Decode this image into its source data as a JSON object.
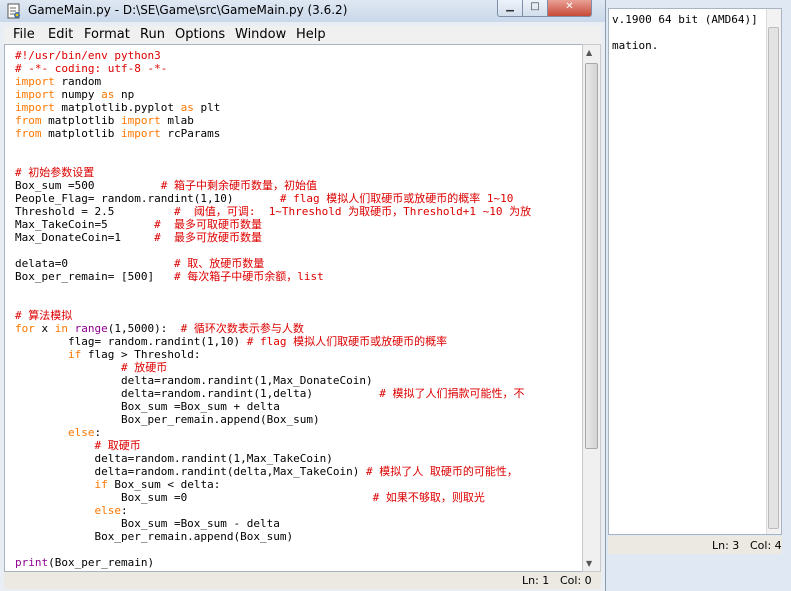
{
  "window": {
    "title": "GameMain.py - D:\\SE\\Game\\src\\GameMain.py (3.6.2)",
    "min_label": "▁",
    "max_label": "□",
    "close_label": "✕"
  },
  "menu": [
    "File",
    "Edit",
    "Format",
    "Run",
    "Options",
    "Window",
    "Help"
  ],
  "code": [
    [
      [
        "cm",
        "#!/usr/bin/env python3"
      ]
    ],
    [
      [
        "cm",
        "# -*- coding: utf-8 -*-"
      ]
    ],
    [
      [
        "kw",
        "import"
      ],
      [
        "nm",
        " random"
      ]
    ],
    [
      [
        "kw",
        "import"
      ],
      [
        "nm",
        " numpy "
      ],
      [
        "kw",
        "as"
      ],
      [
        "nm",
        " np"
      ]
    ],
    [
      [
        "kw",
        "import"
      ],
      [
        "nm",
        " matplotlib.pyplot "
      ],
      [
        "kw",
        "as"
      ],
      [
        "nm",
        " plt"
      ]
    ],
    [
      [
        "kw",
        "from"
      ],
      [
        "nm",
        " matplotlib "
      ],
      [
        "kw",
        "import"
      ],
      [
        "nm",
        " mlab"
      ]
    ],
    [
      [
        "kw",
        "from"
      ],
      [
        "nm",
        " matplotlib "
      ],
      [
        "kw",
        "import"
      ],
      [
        "nm",
        " rcParams"
      ]
    ],
    [],
    [],
    [
      [
        "cm",
        "# 初始参数设置"
      ]
    ],
    [
      [
        "nm",
        "Box_sum =500          "
      ],
      [
        "cm",
        "# 箱子中剩余硬币数量，初始值"
      ]
    ],
    [
      [
        "nm",
        "People_Flag= random.randint(1,10)       "
      ],
      [
        "cm",
        "# flag 模拟人们取硬币或放硬币的概率 1~10"
      ]
    ],
    [
      [
        "nm",
        "Threshold = 2.5         "
      ],
      [
        "cm",
        "#  阈值，可调:  1~Threshold 为取硬币，Threshold+1 ~10 为放"
      ]
    ],
    [
      [
        "nm",
        "Max_TakeCoin=5       "
      ],
      [
        "cm",
        "#  最多可取硬币数量"
      ]
    ],
    [
      [
        "nm",
        "Max_DonateCoin=1     "
      ],
      [
        "cm",
        "#  最多可放硬币数量"
      ]
    ],
    [],
    [
      [
        "nm",
        "delata=0                "
      ],
      [
        "cm",
        "# 取、放硬币数量"
      ]
    ],
    [
      [
        "nm",
        "Box_per_remain= [500]   "
      ],
      [
        "cm",
        "# 每次箱子中硬币余额，list"
      ]
    ],
    [],
    [],
    [
      [
        "cm",
        "# 算法模拟"
      ]
    ],
    [
      [
        "kw",
        "for"
      ],
      [
        "nm",
        " x "
      ],
      [
        "kw",
        "in"
      ],
      [
        "nm",
        " "
      ],
      [
        "bi",
        "range"
      ],
      [
        "nm",
        "(1,5000):  "
      ],
      [
        "cm",
        "# 循环次数表示参与人数"
      ]
    ],
    [
      [
        "nm",
        "        flag= random.randint(1,10) "
      ],
      [
        "cm",
        "# flag 模拟人们取硬币或放硬币的概率"
      ]
    ],
    [
      [
        "nm",
        "        "
      ],
      [
        "kw",
        "if"
      ],
      [
        "nm",
        " flag > Threshold:"
      ]
    ],
    [
      [
        "nm",
        "                "
      ],
      [
        "cm",
        "# 放硬币"
      ]
    ],
    [
      [
        "nm",
        "                delta=random.randint(1,Max_DonateCoin)"
      ]
    ],
    [
      [
        "nm",
        "                delta=random.randint(1,delta)          "
      ],
      [
        "cm",
        "# 模拟了人们捐款可能性，不"
      ]
    ],
    [
      [
        "nm",
        "                Box_sum =Box_sum + delta"
      ]
    ],
    [
      [
        "nm",
        "                Box_per_remain.append(Box_sum)"
      ]
    ],
    [
      [
        "nm",
        "        "
      ],
      [
        "kw",
        "else"
      ],
      [
        "nm",
        ":"
      ]
    ],
    [
      [
        "nm",
        "            "
      ],
      [
        "cm",
        "# 取硬币"
      ]
    ],
    [
      [
        "nm",
        "            delta=random.randint(1,Max_TakeCoin)"
      ]
    ],
    [
      [
        "nm",
        "            delta=random.randint(delta,Max_TakeCoin) "
      ],
      [
        "cm",
        "# 模拟了人 取硬币的可能性，"
      ]
    ],
    [
      [
        "nm",
        "            "
      ],
      [
        "kw",
        "if"
      ],
      [
        "nm",
        " Box_sum < delta:"
      ]
    ],
    [
      [
        "nm",
        "                Box_sum =0                            "
      ],
      [
        "cm",
        "# 如果不够取，则取光"
      ]
    ],
    [
      [
        "nm",
        "            "
      ],
      [
        "kw",
        "else"
      ],
      [
        "nm",
        ":"
      ]
    ],
    [
      [
        "nm",
        "                Box_sum =Box_sum - delta"
      ]
    ],
    [
      [
        "nm",
        "            Box_per_remain.append(Box_sum)"
      ]
    ],
    [],
    [
      [
        "bi",
        "print"
      ],
      [
        "nm",
        "(Box_per_remain)"
      ]
    ]
  ],
  "status": {
    "ln": "Ln: 1",
    "col": "Col: 0"
  },
  "shell": {
    "line1": "v.1900 64 bit (AMD64)]",
    "line2": "mation.",
    "ln": "Ln: 3",
    "col": "Col: 4"
  },
  "colors": {
    "keyword": "#ff7700",
    "comment": "#dd0000",
    "builtin": "#900090"
  }
}
